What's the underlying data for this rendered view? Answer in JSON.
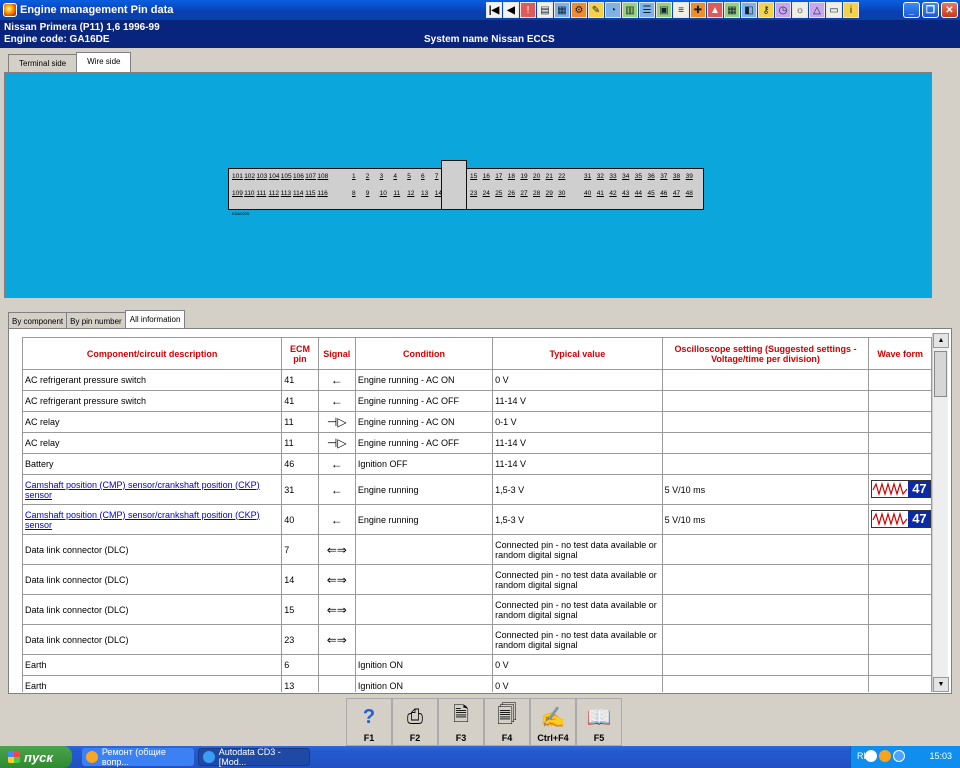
{
  "window": {
    "title": "Engine management Pin data"
  },
  "header": {
    "vehicle": "Nissan   Primera (P11) 1,6   1996-99",
    "engine_code": "Engine code: GA16DE",
    "system": "System name Nissan ECCS"
  },
  "top_tabs": [
    {
      "label": "Terminal side"
    },
    {
      "label": "Wire side"
    }
  ],
  "connector": {
    "label": "KDA0205",
    "top_row": [
      "101",
      "102",
      "103",
      "104",
      "105",
      "106",
      "107",
      "108",
      "1",
      "2",
      "3",
      "4",
      "5",
      "6",
      "7",
      "15",
      "16",
      "17",
      "18",
      "19",
      "20",
      "21",
      "22",
      "31",
      "32",
      "33",
      "34",
      "35",
      "36",
      "37",
      "38",
      "39"
    ],
    "bottom_row": [
      "109",
      "110",
      "111",
      "112",
      "113",
      "114",
      "115",
      "116",
      "8",
      "9",
      "10",
      "11",
      "12",
      "13",
      "14",
      "23",
      "24",
      "25",
      "26",
      "27",
      "28",
      "29",
      "30",
      "40",
      "41",
      "42",
      "43",
      "44",
      "45",
      "46",
      "47",
      "48"
    ]
  },
  "lower_tabs": [
    {
      "label": "By component"
    },
    {
      "label": "By pin number"
    },
    {
      "label": "All information"
    }
  ],
  "table": {
    "headers": {
      "component": "Component/circuit description",
      "pin": "ECM pin",
      "signal": "Signal",
      "condition": "Condition",
      "typical": "Typical value",
      "scope": "Oscilloscope setting (Suggested settings - Voltage/time per division)",
      "wave": "Wave form"
    },
    "rows": [
      {
        "component": "AC refrigerant pressure switch",
        "pin": "41",
        "signal": "←",
        "condition": "Engine running - AC ON",
        "typical": "0 V",
        "scope": "",
        "wave": ""
      },
      {
        "component": "AC refrigerant pressure switch",
        "pin": "41",
        "signal": "←",
        "condition": "Engine running - AC OFF",
        "typical": "11-14 V",
        "scope": "",
        "wave": ""
      },
      {
        "component": "AC relay",
        "pin": "11",
        "signal": "⊣▷",
        "condition": "Engine running - AC ON",
        "typical": "0-1 V",
        "scope": "",
        "wave": ""
      },
      {
        "component": "AC relay",
        "pin": "11",
        "signal": "⊣▷",
        "condition": "Engine running - AC OFF",
        "typical": "11-14 V",
        "scope": "",
        "wave": ""
      },
      {
        "component": "Battery",
        "pin": "46",
        "signal": "←",
        "condition": "Ignition OFF",
        "typical": "11-14 V",
        "scope": "",
        "wave": ""
      },
      {
        "component": "Camshaft position (CMP) sensor/crankshaft position (CKP) sensor",
        "pin": "31",
        "signal": "←",
        "condition": "Engine running",
        "typical": "1,5-3 V",
        "scope": "5 V/10 ms",
        "wave": "47"
      },
      {
        "component": "Camshaft position (CMP) sensor/crankshaft position (CKP) sensor",
        "pin": "40",
        "signal": "←",
        "condition": "Engine running",
        "typical": "1,5-3 V",
        "scope": "5 V/10 ms",
        "wave": "47"
      },
      {
        "component": "Data link connector (DLC)",
        "pin": "7",
        "signal": "⇐⇒",
        "condition": "",
        "typical": "Connected pin - no test data available or random digital signal",
        "scope": "",
        "wave": ""
      },
      {
        "component": "Data link connector (DLC)",
        "pin": "14",
        "signal": "⇐⇒",
        "condition": "",
        "typical": "Connected pin - no test data available or random digital signal",
        "scope": "",
        "wave": ""
      },
      {
        "component": "Data link connector (DLC)",
        "pin": "15",
        "signal": "⇐⇒",
        "condition": "",
        "typical": "Connected pin - no test data available or random digital signal",
        "scope": "",
        "wave": ""
      },
      {
        "component": "Data link connector (DLC)",
        "pin": "23",
        "signal": "⇐⇒",
        "condition": "",
        "typical": "Connected pin - no test data available or random digital signal",
        "scope": "",
        "wave": ""
      },
      {
        "component": "Earth",
        "pin": "6",
        "signal": "",
        "condition": "Ignition ON",
        "typical": "0 V",
        "scope": "",
        "wave": ""
      },
      {
        "component": "Earth",
        "pin": "13",
        "signal": "",
        "condition": "Ignition ON",
        "typical": "0 V",
        "scope": "",
        "wave": ""
      }
    ]
  },
  "function_keys": [
    {
      "label": "F1",
      "icon": "help-icon"
    },
    {
      "label": "F2",
      "icon": "printer-icon"
    },
    {
      "label": "F3",
      "icon": "print-preview-icon"
    },
    {
      "label": "F4",
      "icon": "print-setup-icon"
    },
    {
      "label": "Ctrl+F4",
      "icon": "notes-icon"
    },
    {
      "label": "F5",
      "icon": "book-icon"
    }
  ],
  "taskbar": {
    "start": "пуск",
    "tasks": [
      {
        "label": "Ремонт (общие вопр..."
      },
      {
        "label": "Autodata CD3 - [Mod..."
      }
    ],
    "lang": "RL",
    "clock": "15:03"
  }
}
